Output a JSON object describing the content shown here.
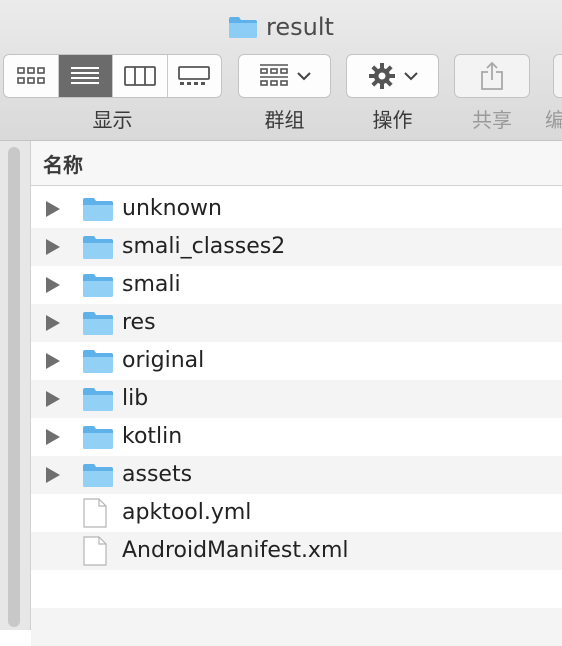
{
  "window": {
    "title": "result"
  },
  "toolbar": {
    "view_label": "显示",
    "group_label": "群组",
    "action_label": "操作",
    "share_label": "共享",
    "edit_label": "编"
  },
  "list": {
    "column_name": "名称",
    "items": [
      {
        "name": "unknown",
        "kind": "folder"
      },
      {
        "name": "smali_classes2",
        "kind": "folder"
      },
      {
        "name": "smali",
        "kind": "folder"
      },
      {
        "name": "res",
        "kind": "folder"
      },
      {
        "name": "original",
        "kind": "folder"
      },
      {
        "name": "lib",
        "kind": "folder"
      },
      {
        "name": "kotlin",
        "kind": "folder"
      },
      {
        "name": "assets",
        "kind": "folder"
      },
      {
        "name": "apktool.yml",
        "kind": "file"
      },
      {
        "name": "AndroidManifest.xml",
        "kind": "file"
      }
    ]
  },
  "colors": {
    "folder": "#6ab8ec",
    "folder_light": "#9fd3f7",
    "selected_segment": "#6b6b6b"
  }
}
